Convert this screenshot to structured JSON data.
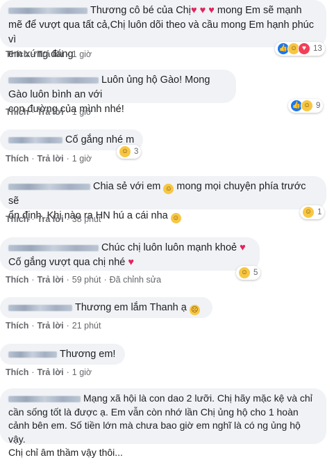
{
  "actions": {
    "like": "Thích",
    "reply": "Trả lời",
    "sep": "·"
  },
  "comments": [
    {
      "text_a": "Thương cô bé của Chị",
      "hearts": "♥ ♥ ♥",
      "text_b": "mong Em sẽ mạnh",
      "line2": "mẽ để vượt qua tất cả,Chị luôn dõi theo và cầu mong Em hạnh phúc vì",
      "line3": "em xứng đáng",
      "time": "1 giờ",
      "reaction_count": "13"
    },
    {
      "line1": "Luôn ủng hộ Gào! Mong Gào luôn bình an với",
      "line2": "con đường của mình nhé!",
      "time": "1 giờ",
      "reaction_count": "9"
    },
    {
      "line1": "Cố gắng nhé m",
      "time": "1 giờ",
      "reaction_count": "3"
    },
    {
      "line1_a": "Chia sẻ với em",
      "line1_b": "mong mọi chuyện phía trước sẽ",
      "line2": "ổn định. Khi nào ra HN hú a cái nha",
      "time": "38 phút",
      "reaction_count": "1"
    },
    {
      "line1": "Chúc chị luôn luôn mạnh khoẻ",
      "line2": "Cố gắng vượt qua chị nhé",
      "time": "59 phút",
      "edited": "Đã chỉnh sửa",
      "reaction_count": "5"
    },
    {
      "line1": "Thương em lắm Thanh ạ",
      "time": "21 phút"
    },
    {
      "line1": "Thương em!",
      "time": "1 giờ"
    },
    {
      "line1": "Mạng xã hội là con dao 2 lưỡi. Chị hãy mặc kệ và chỉ",
      "line2": "cần sống tốt là được ạ. Em vẫn còn nhớ lần Chị ủng hộ cho 1 hoàn",
      "line3": "cảnh bên em. Số tiền lớn mà chưa bao giờ em nghĩ là có ng ủng hộ vậy.",
      "line4": "Chị chỉ âm thầm vậy thôi..."
    }
  ],
  "icons": {
    "like": "like-icon",
    "haha": "haha-icon",
    "love": "love-icon",
    "heart": "heart-emoji",
    "smile": "smile-emoji",
    "sad": "sad-emoji"
  },
  "colors": {
    "bubble": "#f0f2f5",
    "meta": "#65676b",
    "like": "#1877f2",
    "love": "#f33e58",
    "haha": "#f7c744"
  }
}
